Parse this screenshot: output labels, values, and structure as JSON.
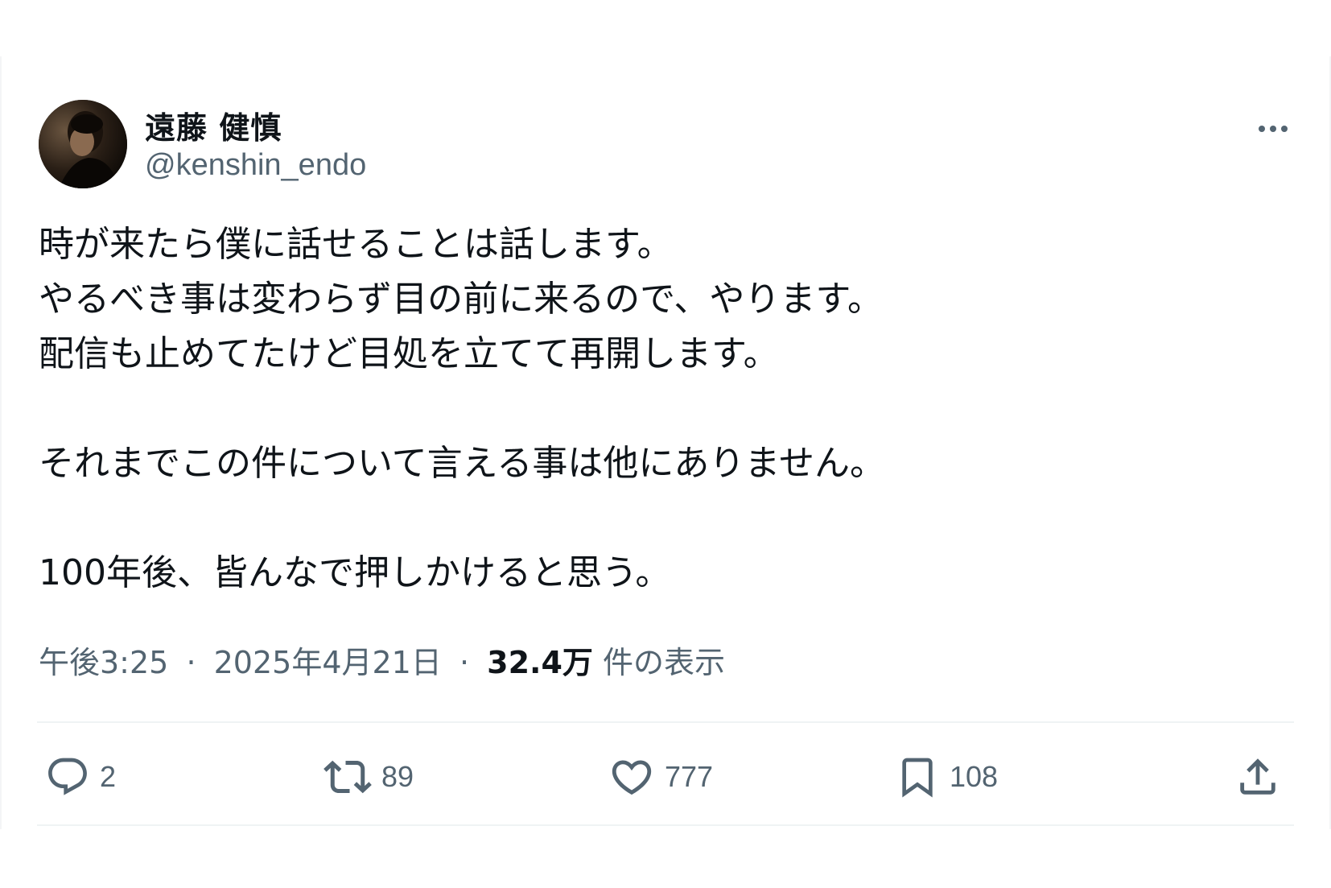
{
  "author": {
    "display_name": "遠藤 健慎",
    "handle": "@kenshin_endo"
  },
  "tweet": {
    "lines": [
      "時が来たら僕に話せることは話します。",
      "やるべき事は変わらず目の前に来るので、やります。",
      "配信も止めてたけど目処を立てて再開します。",
      "",
      "それまでこの件について言える事は他にありません。",
      "",
      "100年後、皆んなで押しかけると思う。"
    ]
  },
  "meta": {
    "time": "午後3:25",
    "date": "2025年4月21日",
    "views_count": "32.4万",
    "views_label": "件の表示",
    "separator": "·"
  },
  "actions": {
    "reply_count": "2",
    "retweet_count": "89",
    "like_count": "777",
    "bookmark_count": "108"
  },
  "icons": {
    "more": "more-horizontal-icon",
    "reply": "reply-icon",
    "retweet": "retweet-icon",
    "like": "heart-icon",
    "bookmark": "bookmark-icon",
    "share": "share-icon"
  }
}
